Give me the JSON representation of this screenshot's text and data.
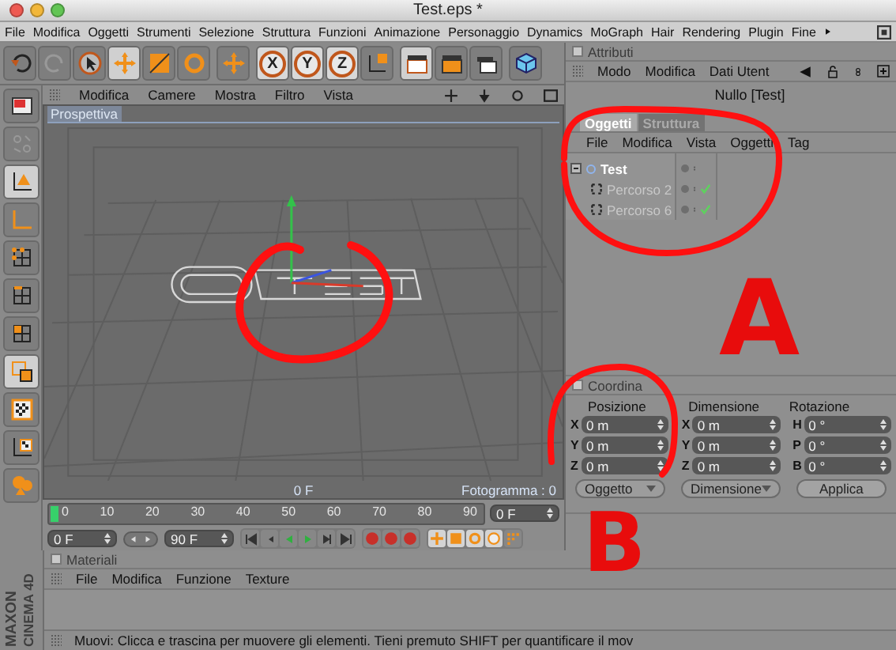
{
  "window": {
    "title": "Test.eps *"
  },
  "menu_bar": [
    "File",
    "Modifica",
    "Oggetti",
    "Strumenti",
    "Selezione",
    "Struttura",
    "Funzioni",
    "Animazione",
    "Personaggio",
    "Dynamics",
    "MoGraph",
    "Hair",
    "Rendering",
    "Plugin",
    "Fine"
  ],
  "toolbar": {
    "axis_buttons": [
      "X",
      "Y",
      "Z"
    ]
  },
  "viewport": {
    "menu": [
      "Modifica",
      "Camere",
      "Mostra",
      "Filtro",
      "Vista"
    ],
    "label": "Prospettiva",
    "frame": "0 F",
    "frame_counter": "Fotogramma : 0"
  },
  "timeline": {
    "ticks": [
      "0",
      "10",
      "20",
      "30",
      "40",
      "50",
      "60",
      "70",
      "80",
      "90"
    ],
    "current_frame": "0 F"
  },
  "transport": {
    "start": "0 F",
    "end": "90 F"
  },
  "attributes": {
    "title": "Attributi",
    "checked": false,
    "menu": [
      "Modo",
      "Modifica",
      "Dati Utent"
    ],
    "object_title": "Nullo [Test]"
  },
  "objects": {
    "tabs": [
      {
        "label": "Oggetti",
        "selected": true
      },
      {
        "label": "Struttura",
        "selected": false
      }
    ],
    "menu": [
      "File",
      "Modifica",
      "Vista",
      "Oggetti",
      "Tag"
    ],
    "tree": [
      {
        "label": "Test",
        "selected": true,
        "expanded": true,
        "children": [
          {
            "label": "Percorso 2",
            "selected": false,
            "checked": true
          },
          {
            "label": "Percorso 6",
            "selected": false,
            "checked": true
          }
        ]
      }
    ]
  },
  "coordinates": {
    "title": "Coordina",
    "checked": false,
    "columns": [
      "Posizione",
      "Dimensione",
      "Rotazione"
    ],
    "rows": [
      [
        {
          "axis": "X",
          "value": "0 m"
        },
        {
          "axis": "X",
          "value": "0 m"
        },
        {
          "axis": "H",
          "value": "0 °"
        }
      ],
      [
        {
          "axis": "Y",
          "value": "0 m"
        },
        {
          "axis": "Y",
          "value": "0 m"
        },
        {
          "axis": "P",
          "value": "0 °"
        }
      ],
      [
        {
          "axis": "Z",
          "value": "0 m"
        },
        {
          "axis": "Z",
          "value": "0 m"
        },
        {
          "axis": "B",
          "value": "0 °"
        }
      ]
    ],
    "dropdowns": [
      "Oggetto",
      "Dimensione"
    ],
    "apply_button": "Applica"
  },
  "materials": {
    "title": "Materiali",
    "checked": false,
    "menu": [
      "File",
      "Modifica",
      "Funzione",
      "Texture"
    ]
  },
  "status_bar": "Muovi: Clicca e trascina per muovere gli elementi. Tieni premuto SHIFT per quantificare il mov",
  "logo": [
    "MAXON",
    "CINEMA 4D"
  ],
  "annotations": [
    "A",
    "B"
  ]
}
